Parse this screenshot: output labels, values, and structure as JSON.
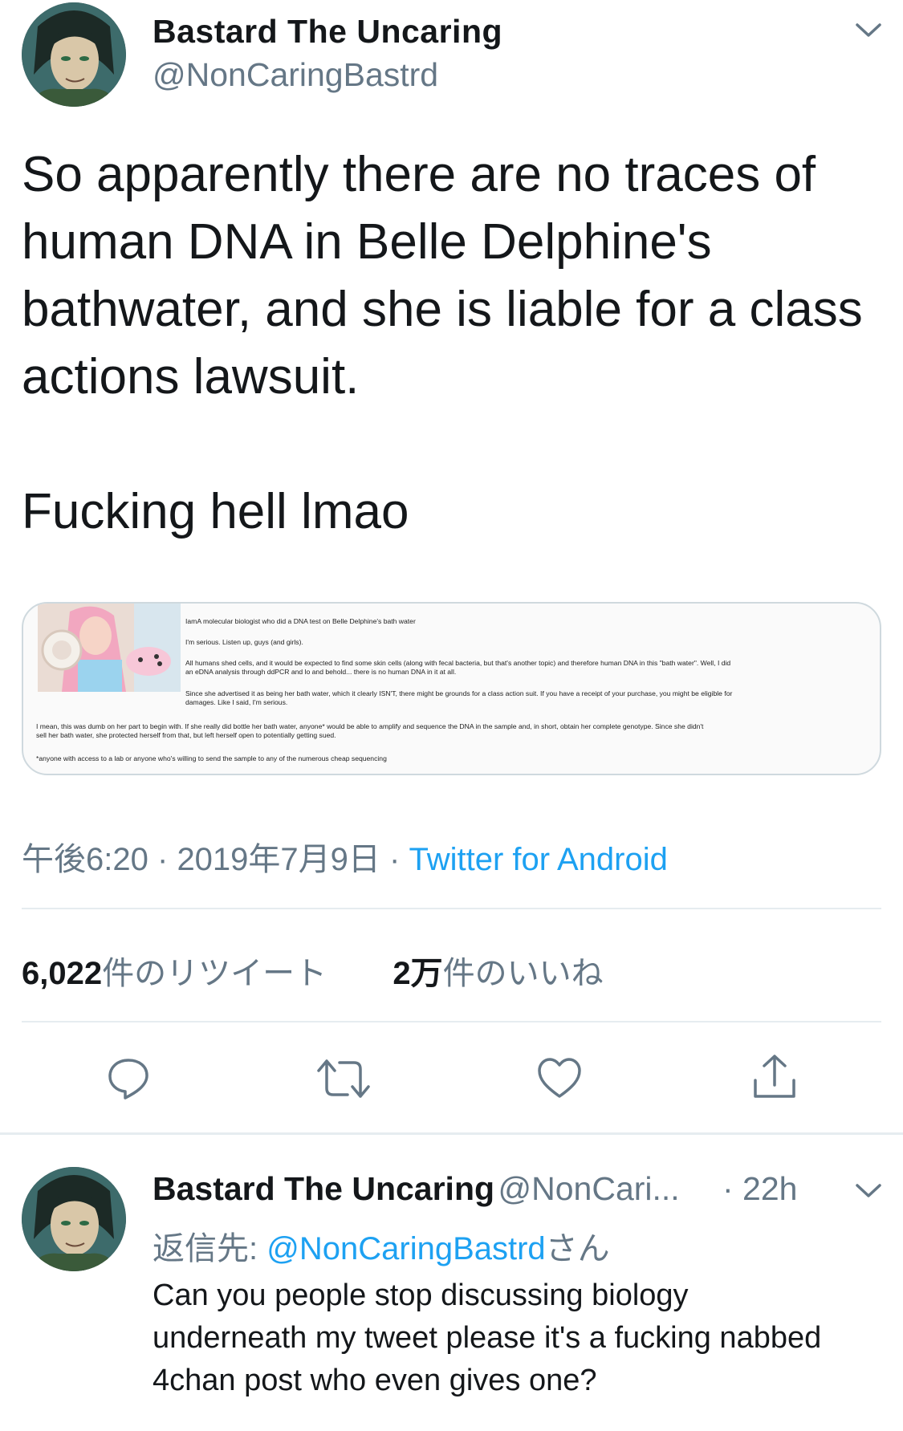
{
  "main_tweet": {
    "display_name": "Bastard The Uncaring",
    "handle": "@NonCaringBastrd",
    "text": "So apparently there are no traces of human DNA in Belle Delphine's bathwater, and she is liable for a class actions lawsuit.\n\nFucking hell lmao",
    "timestamp": "午後6:20",
    "date": "2019年7月9日",
    "separator": "·",
    "source": "Twitter for Android",
    "retweet_count": "6,022",
    "retweet_label": "件のリツイート",
    "like_count": "2万",
    "like_label": "件のいいね",
    "icons": [
      "chevron-down-icon",
      "reply-icon",
      "retweet-icon",
      "like-icon",
      "share-icon"
    ],
    "card": {
      "lines": [
        "IamA molecular biologist who did a DNA test on Belle Delphine's bath water",
        "I'm serious. Listen up, guys (and girls).",
        "All humans shed cells, and it would be expected to find some skin cells (along with fecal bacteria, but that's another topic) and therefore human DNA in this \"bath water\". Well, I did",
        "an eDNA analysis through ddPCR and lo and behold... there is no human DNA in it at all.",
        "Since she advertised it as being her bath water, which it clearly ISN'T, there might be grounds for a class action suit. If you have a receipt of your purchase, you might be eligible for",
        "damages. Like I said, I'm serious.",
        "I mean, this was dumb on her part to begin with. If she really did bottle her bath water, anyone* would be able to amplify and sequence the DNA in the sample and, in short, obtain her complete genotype. Since she didn't",
        "sell her bath water, she protected herself from that, but left herself open to potentially getting sued.",
        "*anyone with access to a lab or anyone who's willing to send the sample to any of the numerous cheap sequencing"
      ]
    }
  },
  "reply_tweet": {
    "display_name": "Bastard The Uncaring",
    "handle": "@NonCari...",
    "time": "· 22h",
    "reply_prefix": "返信先:",
    "reply_mention": "@NonCaringBastrd",
    "reply_suffix": "さん",
    "text": "Can you people stop discussing biology underneath my tweet please it's a fucking nabbed 4chan post who even gives one?"
  },
  "colors": {
    "text": "#14171a",
    "secondary": "#657786",
    "link": "#1da1f2",
    "divider": "#e6ecf0"
  }
}
